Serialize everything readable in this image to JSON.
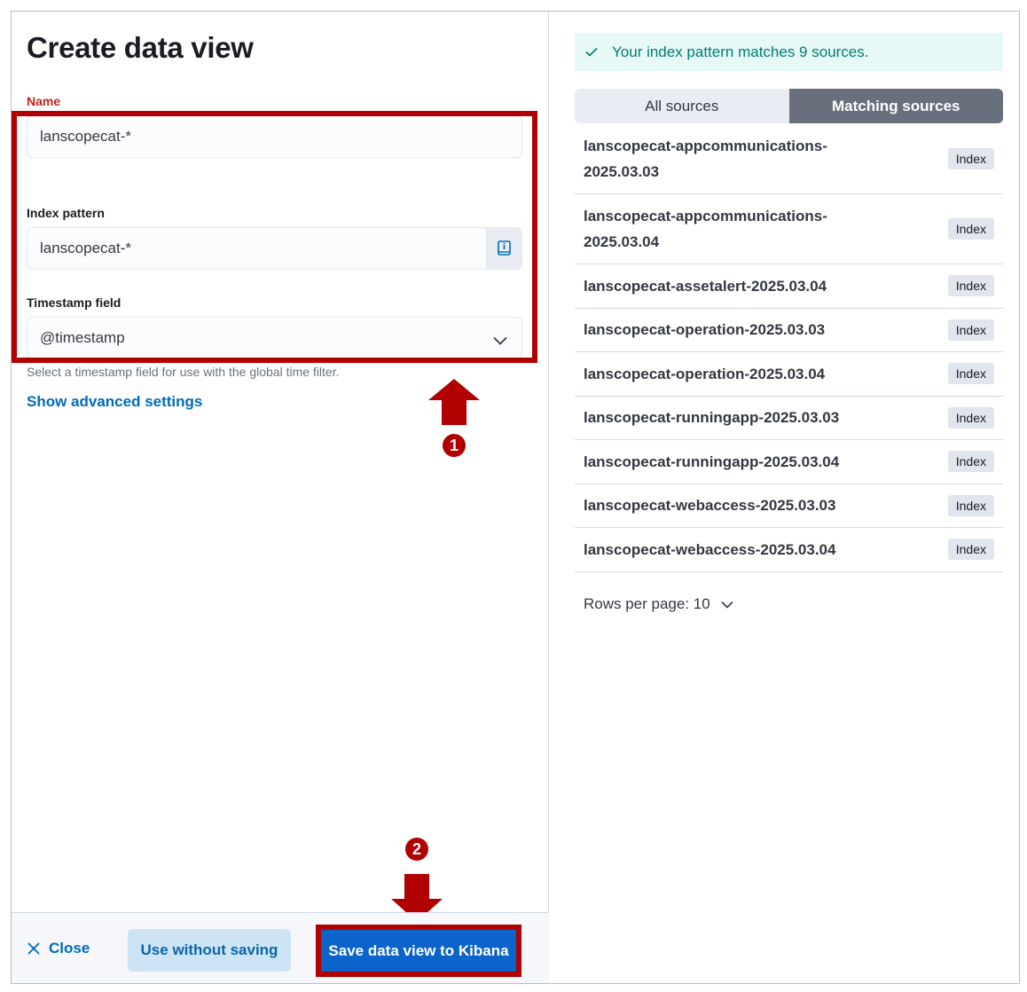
{
  "form": {
    "title": "Create data view",
    "name_label": "Name",
    "name_value": "lanscopecat-*",
    "index_label": "Index pattern",
    "index_value": "lanscopecat-*",
    "timestamp_label": "Timestamp field",
    "timestamp_value": "@timestamp",
    "timestamp_help": "Select a timestamp field for use with the global time filter.",
    "advanced_link": "Show advanced settings"
  },
  "annotations": {
    "step1": "1",
    "step2": "2",
    "color": "#b00000"
  },
  "footer": {
    "close_label": "Close",
    "use_without_saving_label": "Use without saving",
    "save_label": "Save data view to Kibana"
  },
  "preview": {
    "callout": "Your index pattern matches 9 sources.",
    "tabs": [
      {
        "label": "All sources",
        "selected": false
      },
      {
        "label": "Matching sources",
        "selected": true
      }
    ],
    "sources": [
      {
        "name": "lanscopecat-appcommunications-2025.03.03",
        "type": "Index"
      },
      {
        "name": "lanscopecat-appcommunications-2025.03.04",
        "type": "Index"
      },
      {
        "name": "lanscopecat-assetalert-2025.03.04",
        "type": "Index"
      },
      {
        "name": "lanscopecat-operation-2025.03.03",
        "type": "Index"
      },
      {
        "name": "lanscopecat-operation-2025.03.04",
        "type": "Index"
      },
      {
        "name": "lanscopecat-runningapp-2025.03.03",
        "type": "Index"
      },
      {
        "name": "lanscopecat-runningapp-2025.03.04",
        "type": "Index"
      },
      {
        "name": "lanscopecat-webaccess-2025.03.03",
        "type": "Index"
      },
      {
        "name": "lanscopecat-webaccess-2025.03.04",
        "type": "Index"
      }
    ],
    "rows_per_page_label": "Rows per page: 10"
  },
  "icons": {
    "check": "check-icon",
    "close": "close-icon",
    "chevron": "chevron-down-icon",
    "index_help": "index-pattern-help-icon"
  },
  "colors": {
    "link": "#006bb8",
    "primary": "#0b64c9",
    "success": "#017d73",
    "danger": "#bd271e"
  }
}
